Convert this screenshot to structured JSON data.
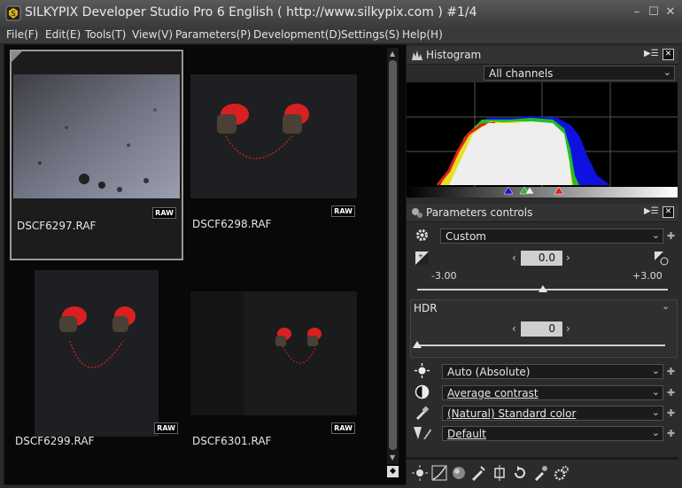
{
  "window": {
    "title": "SILKYPIX Developer Studio Pro 6 English ( http://www.silkypix.com )   #1/4",
    "minimize": "–",
    "maximize": "☐",
    "close": "✕"
  },
  "menu": [
    "File(F)",
    "Edit(E)",
    "Tools(T)",
    "View(V)",
    "Parameters(P)",
    "Development(D)",
    "Settings(S)",
    "Help(H)"
  ],
  "thumbnails": [
    {
      "name": "DSCF6297.RAF",
      "badge": "RAW",
      "selected": true
    },
    {
      "name": "DSCF6298.RAF",
      "badge": "RAW",
      "selected": false
    },
    {
      "name": "DSCF6299.RAF",
      "badge": "RAW",
      "selected": false
    },
    {
      "name": "DSCF6301.RAF",
      "badge": "RAW",
      "selected": false
    }
  ],
  "histogram": {
    "title": "Histogram",
    "channel": "All channels",
    "colors": {
      "red": "#e02020",
      "green": "#20c020",
      "blue": "#1010e0",
      "yellow": "#e8e020",
      "white": "#eeeeee"
    }
  },
  "params": {
    "title": "Parameters controls",
    "preset": "Custom",
    "exposure_value": "0.0",
    "exposure_min": "-3.00",
    "exposure_max": "+3.00",
    "exposure_level": 0.5,
    "hdr_label": "HDR",
    "hdr_value": "0",
    "hdr_level": 0.0,
    "white_balance": "Auto (Absolute)",
    "contrast": "Average contrast",
    "color": "(Natural) Standard color",
    "sharpness": "Default"
  }
}
